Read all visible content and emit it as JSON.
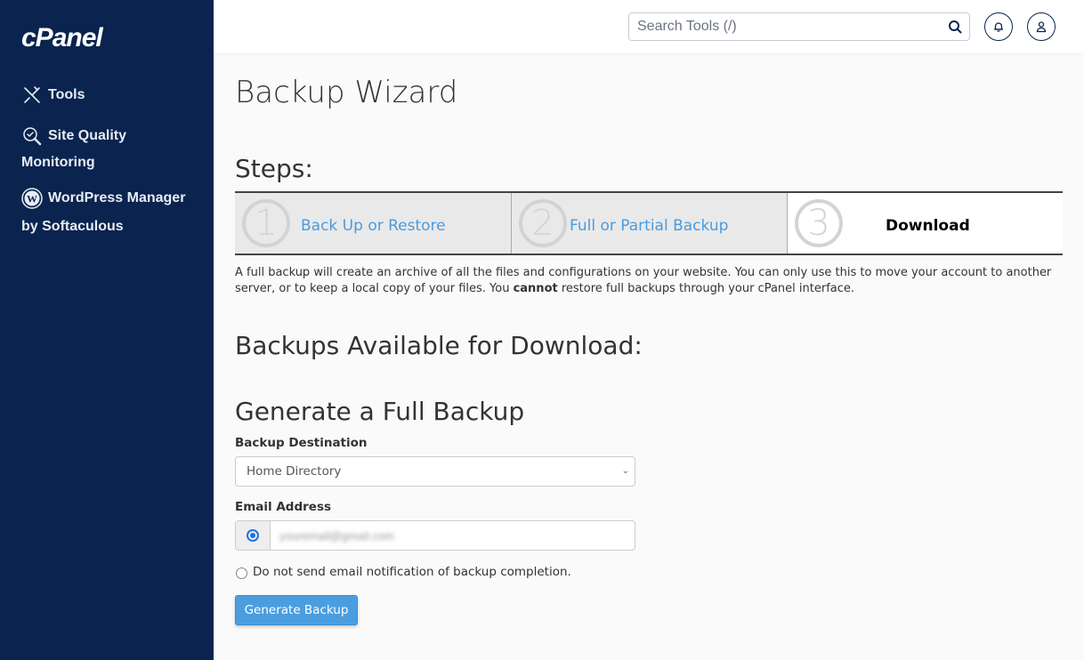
{
  "sidebar": {
    "logo": "cPanel",
    "items": [
      {
        "label": "Tools",
        "icon": "tools-icon"
      },
      {
        "label": "Site Quality",
        "label2": "Monitoring",
        "icon": "site-quality-icon"
      },
      {
        "label": "WordPress Manager",
        "label2": "by Softaculous",
        "icon": "wordpress-icon"
      }
    ]
  },
  "topbar": {
    "search_placeholder": "Search Tools (/)",
    "icons": [
      "search-icon",
      "bell-icon",
      "user-icon"
    ]
  },
  "main": {
    "title": "Backup Wizard",
    "steps_heading": "Steps:",
    "steps": [
      {
        "number": "1",
        "label": "Back Up or Restore",
        "active": false
      },
      {
        "number": "2",
        "label": "Full or Partial Backup",
        "active": false
      },
      {
        "number": "3",
        "label": "Download",
        "active": true
      }
    ],
    "description_part1": "A full backup will create an archive of all the files and configurations on your website. You can only use this to move your account to another server, or to keep a local copy of your files. You ",
    "description_bold": "cannot",
    "description_part2": " restore full backups through your cPanel interface.",
    "available_heading": "Backups Available for Download:",
    "generate_heading": "Generate a Full Backup",
    "destination_label": "Backup Destination",
    "destination_value": "Home Directory",
    "email_label": "Email Address",
    "email_value": "youremail@gmail.com",
    "no_email_label": "Do not send email notification of backup completion.",
    "generate_button": "Generate Backup"
  }
}
